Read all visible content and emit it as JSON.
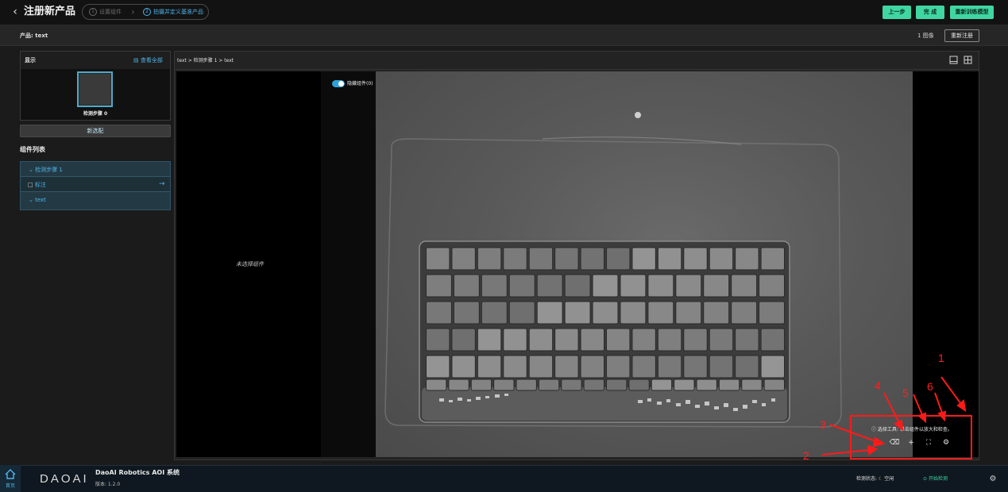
{
  "header": {
    "title": "注册新产品",
    "steps": [
      {
        "num": "1",
        "label": "设置组件"
      },
      {
        "num": "2",
        "label": "拍摄并定义基准产品"
      }
    ],
    "prev_label": "上一步",
    "done_label": "完 成",
    "retrain_label": "重新训练模型"
  },
  "product_bar": {
    "label": "产品: text",
    "count": "1 图像",
    "reregister_label": "重新注册"
  },
  "left_panel": {
    "display_title": "显示",
    "view_all": "查看全部",
    "thumb_caption": "检测步骤 0",
    "new_select_label": "新选配",
    "component_list_title": "组件列表",
    "tree": [
      {
        "label": "检测步骤 1"
      },
      {
        "label": "标注"
      },
      {
        "label": "text"
      }
    ]
  },
  "viewer": {
    "breadcrumb": "text > 检测步骤 1 > text",
    "no_selection": "未选择组件",
    "hide_components": "隐藏组件(0)",
    "tool_tip": "选择工具: 单击组件以放大和检查。",
    "annotations": [
      "1",
      "2",
      "3",
      "4",
      "5",
      "6"
    ]
  },
  "footer": {
    "home_label": "首页",
    "logo": "DAOAI",
    "system_title": "DaoAI Robotics AOI 系统",
    "version": "版本: 1.2.0",
    "status_label": "检测状态:",
    "status_value": "空闲",
    "start_label": "开始检测"
  },
  "colors": {
    "accent": "#4fb3e8",
    "green": "#3fd6a2",
    "annotation_red": "#ff1a1a"
  }
}
